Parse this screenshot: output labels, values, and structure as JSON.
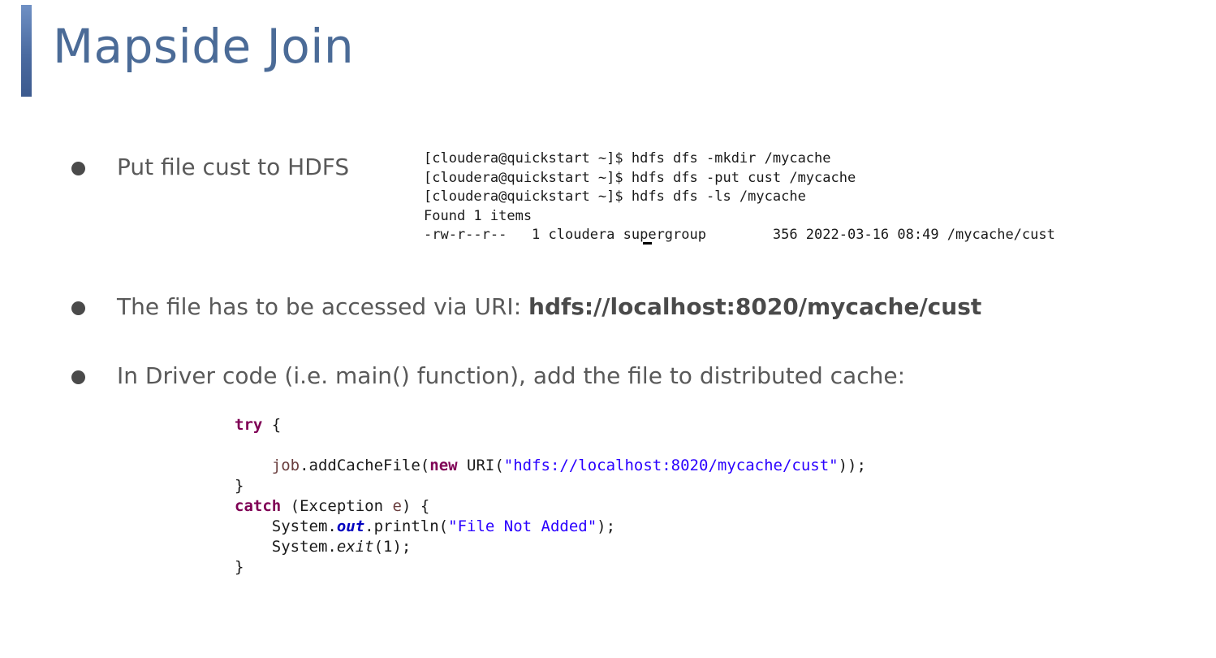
{
  "slide": {
    "title": "Mapside Join",
    "accent_color": "#4b6b97"
  },
  "bullets": [
    {
      "text": "Put file cust to HDFS"
    },
    {
      "text_prefix": "The file has to be accessed via URI:  ",
      "uri": "hdfs://localhost:8020/mycache/cust"
    },
    {
      "text": "In Driver code (i.e. main() function), add the file to distributed cache:"
    }
  ],
  "terminal": {
    "lines": [
      "[cloudera@quickstart ~]$ hdfs dfs -mkdir /mycache",
      "[cloudera@quickstart ~]$ hdfs dfs -put cust /mycache",
      "[cloudera@quickstart ~]$ hdfs dfs -ls /mycache",
      "Found 1 items",
      "-rw-r--r--   1 cloudera supergroup        356 2022-03-16 08:49 /mycache/cust"
    ]
  },
  "code": {
    "kw_try": "try",
    "brace_open": " {",
    "job_var": "job",
    "add_cache": ".addCacheFile(",
    "kw_new": "new",
    "uri_call": " URI(",
    "uri_string": "\"hdfs://localhost:8020/mycache/cust\"",
    "close_call": "));",
    "brace_close": "}",
    "kw_catch": "catch",
    "exception_sig": " (Exception ",
    "exception_var": "e",
    "exception_close": ") {",
    "system_1": "System.",
    "out_field": "out",
    "println": ".println(",
    "msg_string": "\"File Not Added\"",
    "println_close": ");",
    "system_2": "System.",
    "exit_method": "exit",
    "exit_args": "(1);",
    "final_brace": "}"
  }
}
